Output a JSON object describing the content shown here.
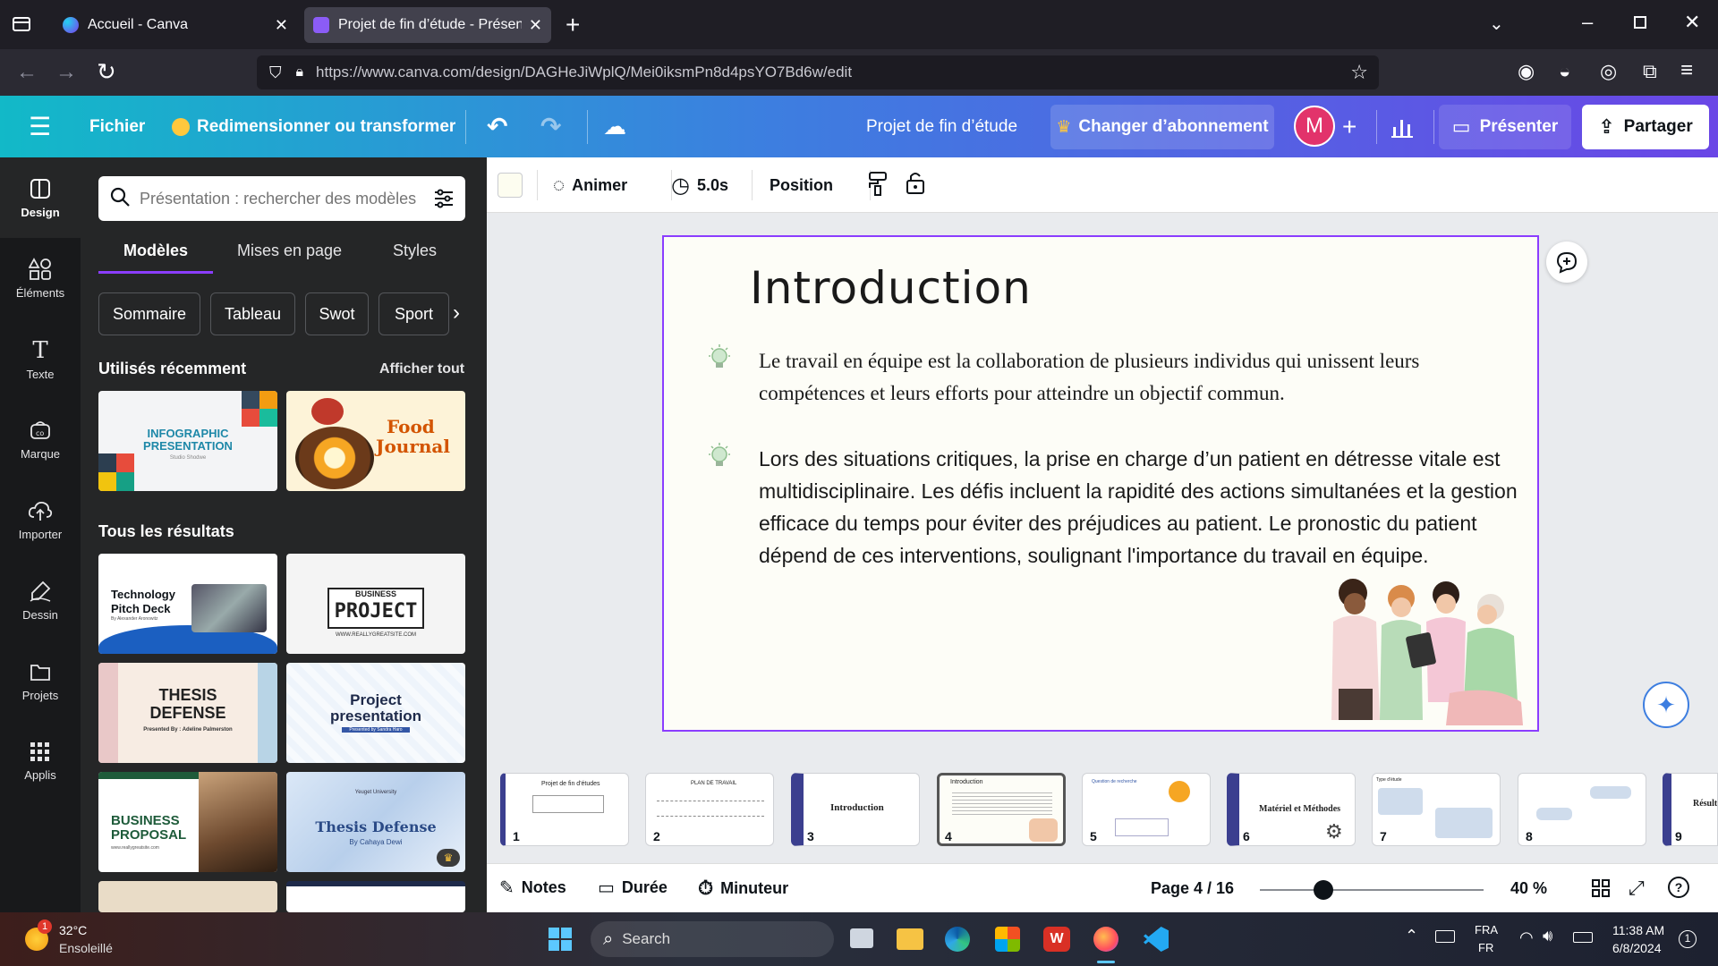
{
  "browser": {
    "tabs": [
      {
        "label": "Accueil - Canva",
        "active": false
      },
      {
        "label": "Projet de fin d’étude - Présentati",
        "active": true
      }
    ],
    "url": "https://www.canva.com/design/DAGHeJiWplQ/Mei0iksmPn8d4psYO7Bd6w/edit"
  },
  "header": {
    "fichier": "Fichier",
    "resize": "Redimensionner ou transformer",
    "title": "Projet de fin d’étude",
    "upgrade": "Changer d’abonnement",
    "avatar": "M",
    "present": "Présenter",
    "share": "Partager"
  },
  "rail": [
    {
      "label": "Design"
    },
    {
      "label": "Éléments"
    },
    {
      "label": "Texte"
    },
    {
      "label": "Marque"
    },
    {
      "label": "Importer"
    },
    {
      "label": "Dessin"
    },
    {
      "label": "Projets"
    },
    {
      "label": "Applis"
    }
  ],
  "panel": {
    "search_placeholder": "Présentation : rechercher des modèles",
    "tabs": [
      "Modèles",
      "Mises en page",
      "Styles"
    ],
    "chips": [
      "Sommaire",
      "Tableau",
      "Swot",
      "Sport"
    ],
    "recent_title": "Utilisés récemment",
    "see_all": "Afficher tout",
    "recent": [
      {
        "line1": "INFOGRAPHIC",
        "line2": "PRESENTATION",
        "sub": "Studio Shodwe"
      },
      {
        "line1": "Food",
        "line2": "Journal"
      }
    ],
    "all_title": "Tous les résultats",
    "results": [
      {
        "line1": "Technology",
        "line2": "Pitch Deck",
        "sub": "By Alexander Aronowitz"
      },
      {
        "line1": "BUSINESS",
        "line2": "PROJECT",
        "sub": "WWW.REALLYGREATSITE.COM"
      },
      {
        "line1": "THESIS",
        "line2": "DEFENSE",
        "sub": "Presented By : Adeline Palmerston"
      },
      {
        "line1": "Project",
        "line2": "presentation",
        "sub": "Presented by Sandra Haro"
      },
      {
        "line1": "BUSINESS",
        "line2": "PROPOSAL",
        "sub": "www.reallygreatsite.com"
      },
      {
        "line1": "Thesis Defense",
        "line2": "By Cahaya Dewi",
        "sub": "Yeuget University"
      }
    ]
  },
  "toolbar": {
    "animate": "Animer",
    "duration": "5.0s",
    "position": "Position"
  },
  "slide": {
    "title": "Introduction",
    "para1": "Le travail en équipe est la collaboration de plusieurs individus qui unissent leurs compétences et leurs efforts pour atteindre un objectif commun.",
    "para2": "Lors des situations critiques, la prise en charge d’un patient en détresse vitale est multidisciplinaire. Les défis incluent la rapidité des actions simultanées et la gestion efficace du temps pour éviter des préjudices au patient. Le pronostic du patient dépend de ces interventions, soulignant l'importance du travail en équipe."
  },
  "filmstrip": [
    {
      "num": "1",
      "title": "Projet de fin d'études"
    },
    {
      "num": "2",
      "title": "PLAN DE TRAVAIL"
    },
    {
      "num": "3",
      "title": "Introduction"
    },
    {
      "num": "4",
      "title": "Introduction"
    },
    {
      "num": "5",
      "title": "Question de recherche"
    },
    {
      "num": "6",
      "title": "Matériel et Méthodes"
    },
    {
      "num": "7",
      "title": "Type d'étude"
    },
    {
      "num": "8",
      "title": ""
    },
    {
      "num": "9",
      "title": "Résult"
    }
  ],
  "bottombar": {
    "notes": "Notes",
    "duree": "Durée",
    "minuteur": "Minuteur",
    "page": "Page 4 / 16",
    "zoom": "40 %",
    "zoom_level": 0.4
  },
  "taskbar": {
    "temp": "32°C",
    "weather": "Ensoleillé",
    "weather_badge": "1",
    "search": "Search",
    "lang1": "FRA",
    "lang2": "FR",
    "time": "11:38 AM",
    "date": "6/8/2024",
    "notif": "1"
  },
  "colors": {
    "accent": "#8b3dff",
    "header_start": "#12b9c8",
    "header_end": "#6a46e6",
    "avatar": "#e2336b"
  }
}
